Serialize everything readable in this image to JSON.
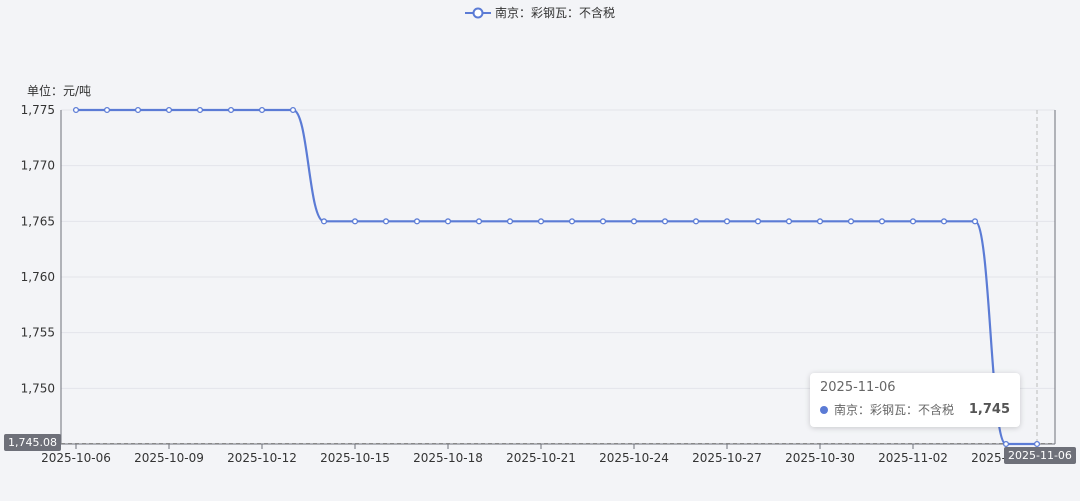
{
  "legend": {
    "label": "南京：彩钢瓦：不含税"
  },
  "unit_label": "单位：元/吨",
  "colors": {
    "series": "#5b7bd5",
    "axis": "#6e7079",
    "grid": "#e3e5ea",
    "bg": "#f3f4f7"
  },
  "tooltip": {
    "date": "2025-11-06",
    "series_name": "南京：彩钢瓦：不含税",
    "value": "1,745"
  },
  "axis_pointer": {
    "y_label": "1,745.08",
    "x_label": "2025-11-06"
  },
  "chart_data": {
    "type": "line",
    "ylim": [
      1745,
      1775
    ],
    "yticks": [
      "1,745",
      "1,750",
      "1,755",
      "1,760",
      "1,765",
      "1,770",
      "1,775"
    ],
    "xtick_labels": [
      "2025-10-06",
      "2025-10-09",
      "2025-10-12",
      "2025-10-15",
      "2025-10-18",
      "2025-10-21",
      "2025-10-24",
      "2025-10-27",
      "2025-10-30",
      "2025-11-02",
      "2025-11-05"
    ],
    "series": [
      {
        "name": "南京：彩钢瓦：不含税",
        "x": [
          "2025-10-06",
          "2025-10-07",
          "2025-10-08",
          "2025-10-09",
          "2025-10-10",
          "2025-10-11",
          "2025-10-12",
          "2025-10-13",
          "2025-10-14",
          "2025-10-15",
          "2025-10-16",
          "2025-10-17",
          "2025-10-18",
          "2025-10-19",
          "2025-10-20",
          "2025-10-21",
          "2025-10-22",
          "2025-10-23",
          "2025-10-24",
          "2025-10-25",
          "2025-10-26",
          "2025-10-27",
          "2025-10-28",
          "2025-10-29",
          "2025-10-30",
          "2025-10-31",
          "2025-11-01",
          "2025-11-02",
          "2025-11-03",
          "2025-11-04",
          "2025-11-05",
          "2025-11-06"
        ],
        "values": [
          1775,
          1775,
          1775,
          1775,
          1775,
          1775,
          1775,
          1775,
          1765,
          1765,
          1765,
          1765,
          1765,
          1765,
          1765,
          1765,
          1765,
          1765,
          1765,
          1765,
          1765,
          1765,
          1765,
          1765,
          1765,
          1765,
          1765,
          1765,
          1765,
          1765,
          1745,
          1745
        ]
      }
    ]
  }
}
